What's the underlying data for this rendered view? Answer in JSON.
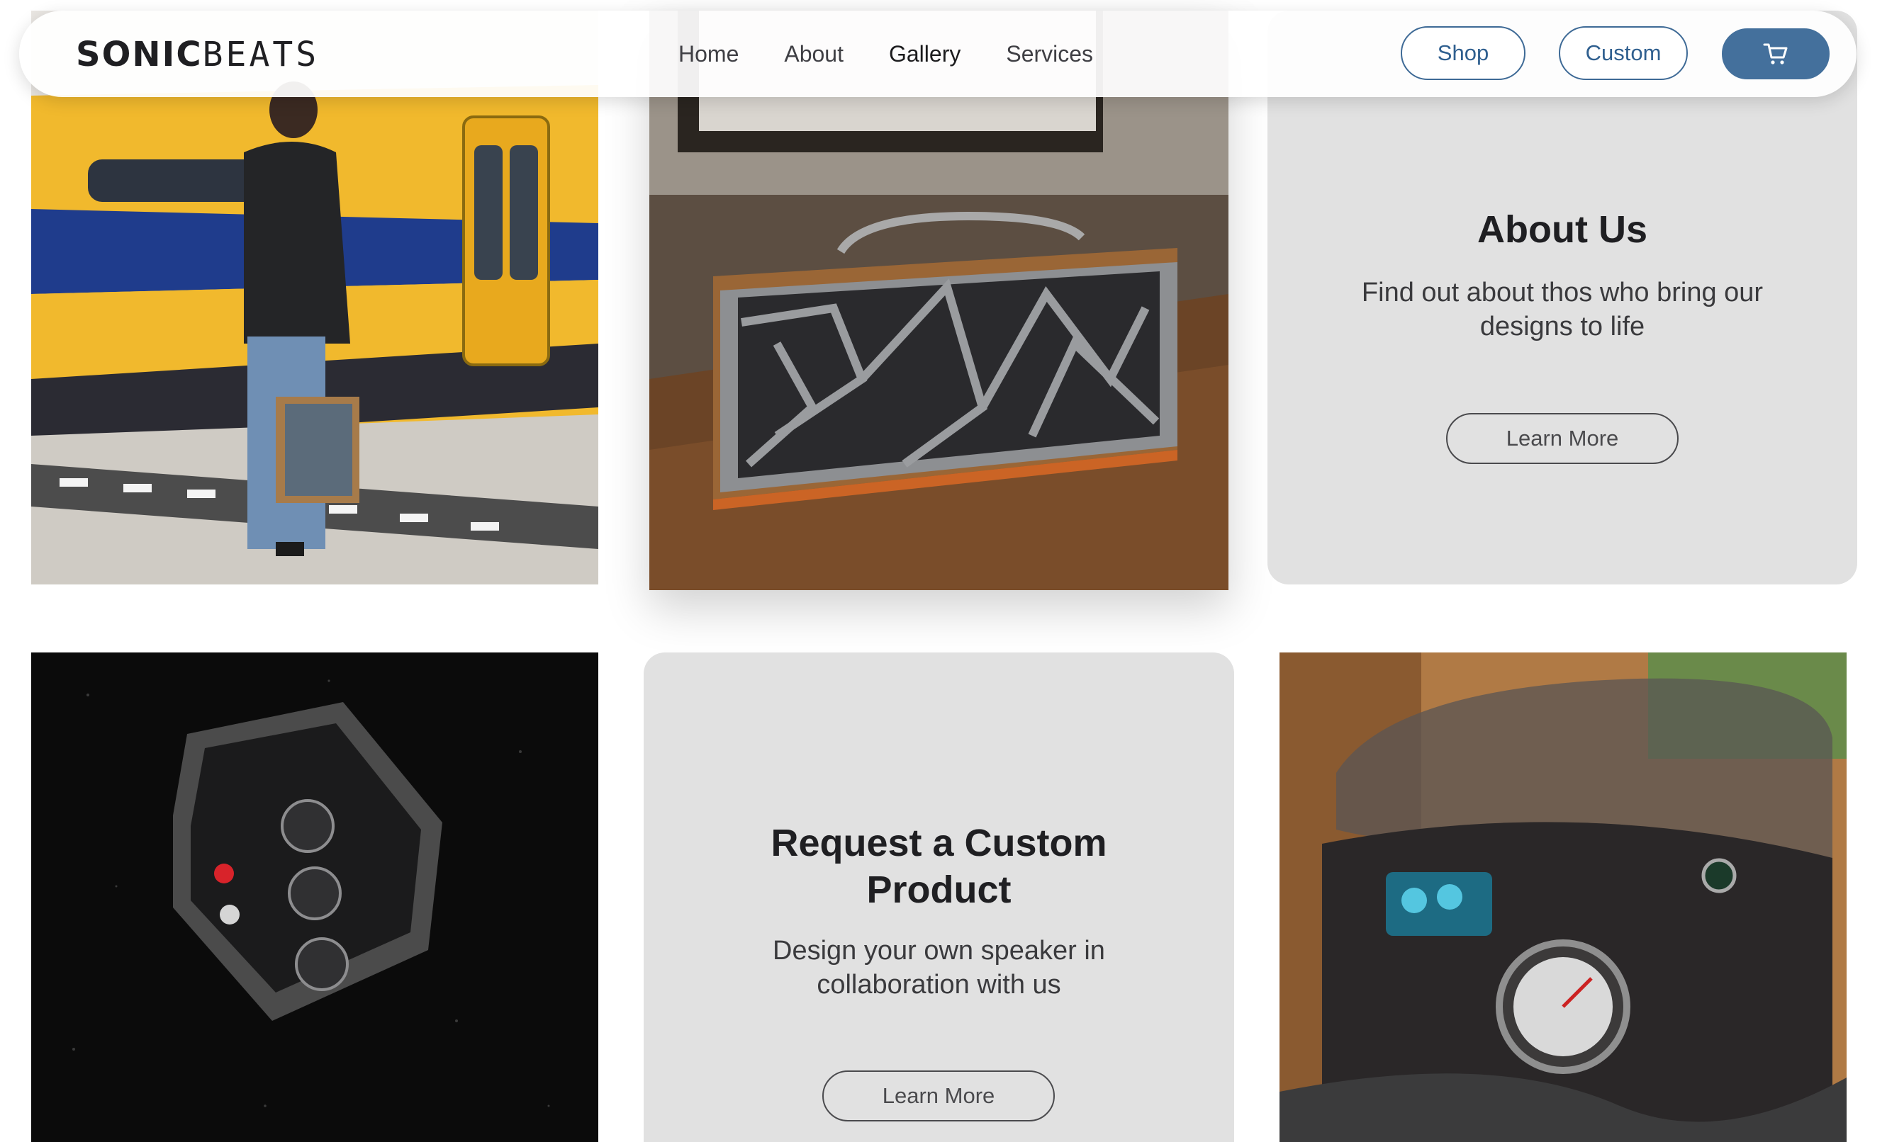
{
  "brand": {
    "name_part1": "SONIC",
    "name_part2": "BEATS"
  },
  "nav": {
    "links": [
      {
        "label": "Home",
        "active": false
      },
      {
        "label": "About",
        "active": false
      },
      {
        "label": "Gallery",
        "active": true
      },
      {
        "label": "Services",
        "active": false
      }
    ],
    "shop_label": "Shop",
    "custom_label": "Custom",
    "cart_icon": "cart-icon"
  },
  "colors": {
    "accent": "#44709c",
    "card_bg": "#e1e1e1",
    "text_dark": "#1f1f22"
  },
  "gallery": {
    "about_card": {
      "title": "About Us",
      "text": "Find out about thos who bring our designs to life",
      "button": "Learn More"
    },
    "custom_card": {
      "title": "Request a Custom Product",
      "text": "Design your own speaker in collaboration with us",
      "button": "Learn More"
    },
    "images": [
      {
        "subject": "man-at-train-platform-with-speaker"
      },
      {
        "subject": "wooden-speaker-with-geometric-grille"
      },
      {
        "subject": "hexagonal-control-panel-with-knobs"
      },
      {
        "subject": "motorcycle-dashboard-with-screen"
      }
    ]
  }
}
